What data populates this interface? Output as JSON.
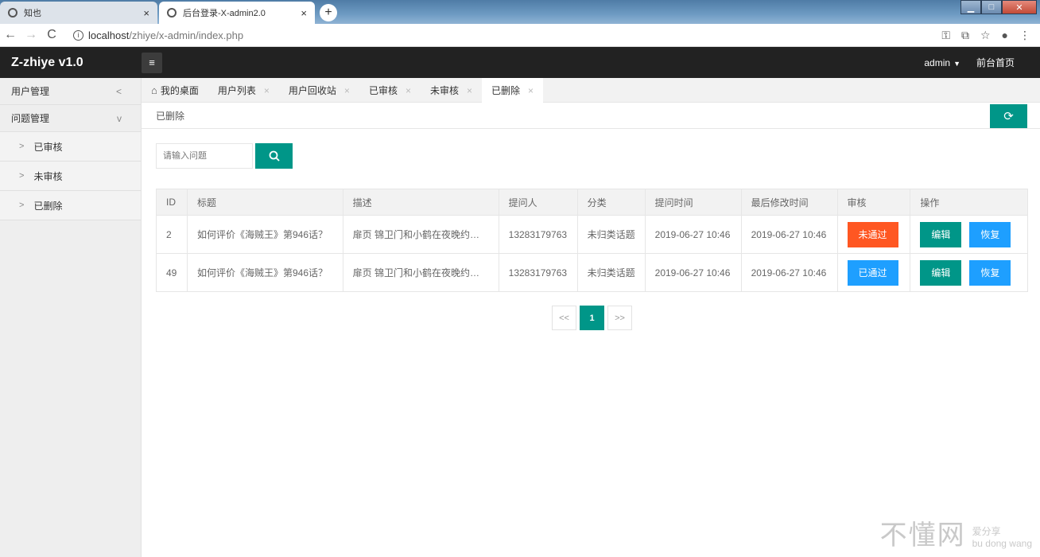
{
  "browser": {
    "tabs": [
      {
        "title": "知也",
        "active": false
      },
      {
        "title": "后台登录-X-admin2.0",
        "active": true
      }
    ],
    "new_tab": "+",
    "url_host": "localhost",
    "url_path": "/zhiye/x-admin/index.php",
    "back": "←",
    "forward": "→",
    "reload": "C",
    "close": "×"
  },
  "header": {
    "logo": "Z-zhiye v1.0",
    "menu_icon": "≡",
    "user": "admin",
    "frontpage": "前台首页"
  },
  "sidebar": {
    "items": [
      {
        "label": "用户管理",
        "arrow": "<"
      },
      {
        "label": "问题管理",
        "arrow": "v"
      }
    ],
    "subitems": [
      {
        "label": "已审核"
      },
      {
        "label": "未审核"
      },
      {
        "label": "已删除"
      }
    ]
  },
  "content_tabs": [
    {
      "label": "我的桌面"
    },
    {
      "label": "用户列表"
    },
    {
      "label": "用户回收站"
    },
    {
      "label": "已审核"
    },
    {
      "label": "未审核"
    },
    {
      "label": "已删除"
    }
  ],
  "breadcrumb": "已删除",
  "search": {
    "placeholder": "请输入问题"
  },
  "table": {
    "headers": [
      "ID",
      "标题",
      "描述",
      "提问人",
      "分类",
      "提问时间",
      "最后修改时间",
      "审核",
      "操作"
    ],
    "rows": [
      {
        "id": "2",
        "title": "如何评价《海贼王》第946话？",
        "desc": "扉页 锦卫门和小鹤在夜晚约会…",
        "asker": "13283179763",
        "category": "未归类话题",
        "created": "2019-06-27 10:46",
        "modified": "2019-06-27 10:46",
        "audit": "未通过",
        "audit_state": "fail"
      },
      {
        "id": "49",
        "title": "如何评价《海贼王》第946话？",
        "desc": "扉页 锦卫门和小鹤在夜晚约会…",
        "asker": "13283179763",
        "category": "未归类话题",
        "created": "2019-06-27 10:46",
        "modified": "2019-06-27 10:46",
        "audit": "已通过",
        "audit_state": "pass"
      }
    ],
    "edit_label": "编辑",
    "restore_label": "恢复"
  },
  "pagination": {
    "prev": "<<",
    "current": "1",
    "next": ">>"
  },
  "watermark": {
    "main": "不懂网",
    "sub1": "爱分享",
    "sub2": "bu dong wang"
  },
  "colors": {
    "teal": "#009688",
    "blue": "#1e9fff",
    "orange": "#ff5722",
    "header": "#222222"
  }
}
